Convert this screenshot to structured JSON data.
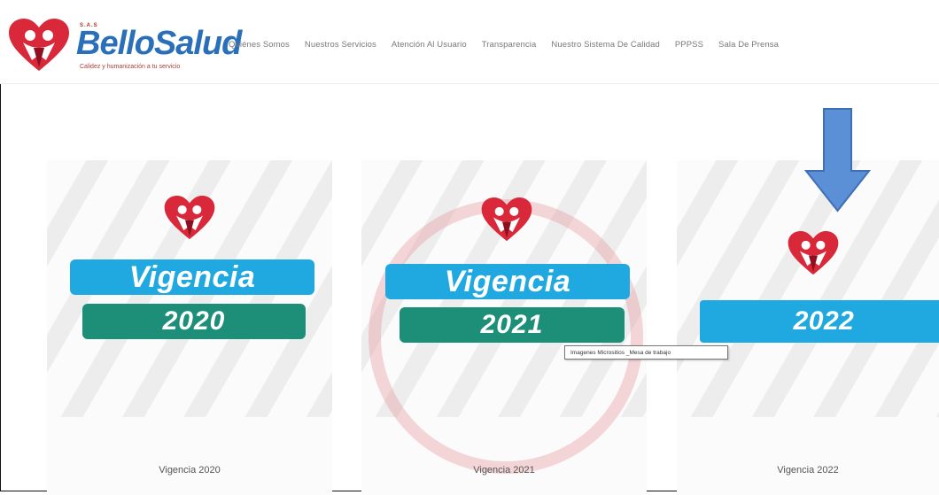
{
  "header": {
    "brand_prefix": "S.A.S",
    "brand_name": "BelloSalud",
    "tagline": "Calidez y humanización a tu servicio",
    "nav": [
      "Quiénes Somos",
      "Nuestros Servicios",
      "Atención Al Usuario",
      "Transparencia",
      "Nuestro Sistema De Calidad",
      "PPPSS",
      "Sala De Prensa"
    ]
  },
  "cards": [
    {
      "word": "Vigencia",
      "year": "2020",
      "title": "Vigencia 2020"
    },
    {
      "word": "Vigencia",
      "year": "2021",
      "title": "Vigencia 2021"
    },
    {
      "year": "2022",
      "title": "Vigencia 2022"
    }
  ],
  "tooltip": "Imagenes Micrositios _Mesa de trabajo",
  "colors": {
    "brand_blue": "#2a6fba",
    "heart_red": "#d8283a",
    "pill_blue": "#1fa9e0",
    "pill_green": "#1d8f78",
    "arrow_blue": "#5b8fd6"
  }
}
